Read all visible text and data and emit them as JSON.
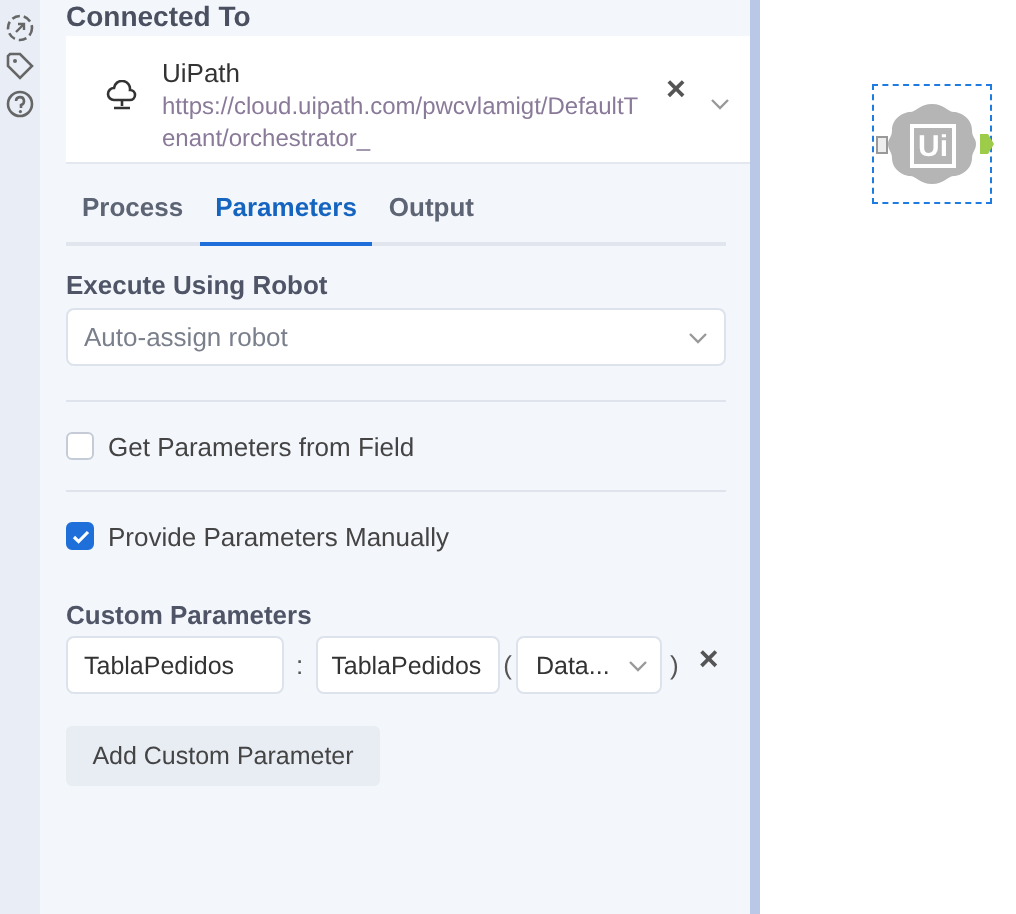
{
  "panel": {
    "heading": "Connected To",
    "connection": {
      "name": "UiPath",
      "url": "https://cloud.uipath.com/pwcvlamigt/DefaultTenant/orchestrator_",
      "remove": "×"
    },
    "tabs": [
      {
        "label": "Process",
        "selected": false
      },
      {
        "label": "Parameters",
        "selected": true
      },
      {
        "label": "Output",
        "selected": false
      }
    ],
    "robot": {
      "label": "Execute Using Robot",
      "value": "Auto-assign robot"
    },
    "options": [
      {
        "label": "Get Parameters from Field",
        "checked": false
      },
      {
        "label": "Provide Parameters Manually",
        "checked": true
      }
    ],
    "custom": {
      "label": "Custom Parameters",
      "rows": [
        {
          "name": "TablaPedidos",
          "colon": ":",
          "value": "TablaPedidos",
          "open": "(",
          "type": "Data...",
          "close": ")",
          "remove": "×"
        }
      ],
      "add_button": "Add Custom Parameter"
    }
  },
  "canvas": {
    "node": {
      "logo": "Ui"
    }
  }
}
